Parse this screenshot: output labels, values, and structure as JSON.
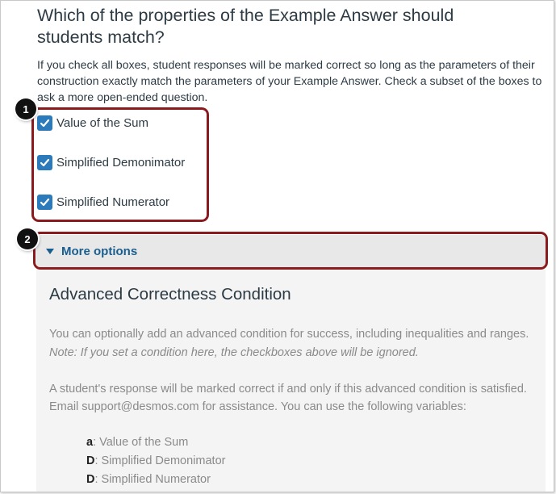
{
  "question": {
    "heading": "Which of the properties of the Example Answer should students match?",
    "description": "If you check all boxes, student responses will be marked correct so long as the parameters of their construction exactly match the parameters of your Example Answer. Check a subset of the boxes to ask a more open-ended question."
  },
  "checkboxes": [
    {
      "label": "Value of the Sum",
      "checked": true
    },
    {
      "label": "Simplified Demonimator",
      "checked": true
    },
    {
      "label": "Simplified Numerator",
      "checked": true
    }
  ],
  "callouts": [
    "1",
    "2"
  ],
  "more_options": {
    "label": "More options"
  },
  "advanced": {
    "title": "Advanced Correctness Condition",
    "p1_text": "You can optionally add an advanced condition for success, including inequalities and ranges. ",
    "p1_note": "Note: If you set a condition here, the checkboxes above will be ignored.",
    "p2_text": "A student's response will be marked correct if and only if this advanced condition is satisfied. Email support@desmos.com for assistance. You can use the following variables:",
    "variables": [
      {
        "var": "a",
        "desc": ": Value of the Sum"
      },
      {
        "var": "D",
        "desc": ": Simplified Demonimator"
      },
      {
        "var": "D",
        "desc": ": Simplified Numerator"
      }
    ]
  },
  "colors": {
    "checkbox": "#2b7abc",
    "callout_border": "#8b1a1f",
    "link": "#1a5e8e"
  },
  "icons": [
    "checkmark-icon",
    "caret-down-icon"
  ]
}
